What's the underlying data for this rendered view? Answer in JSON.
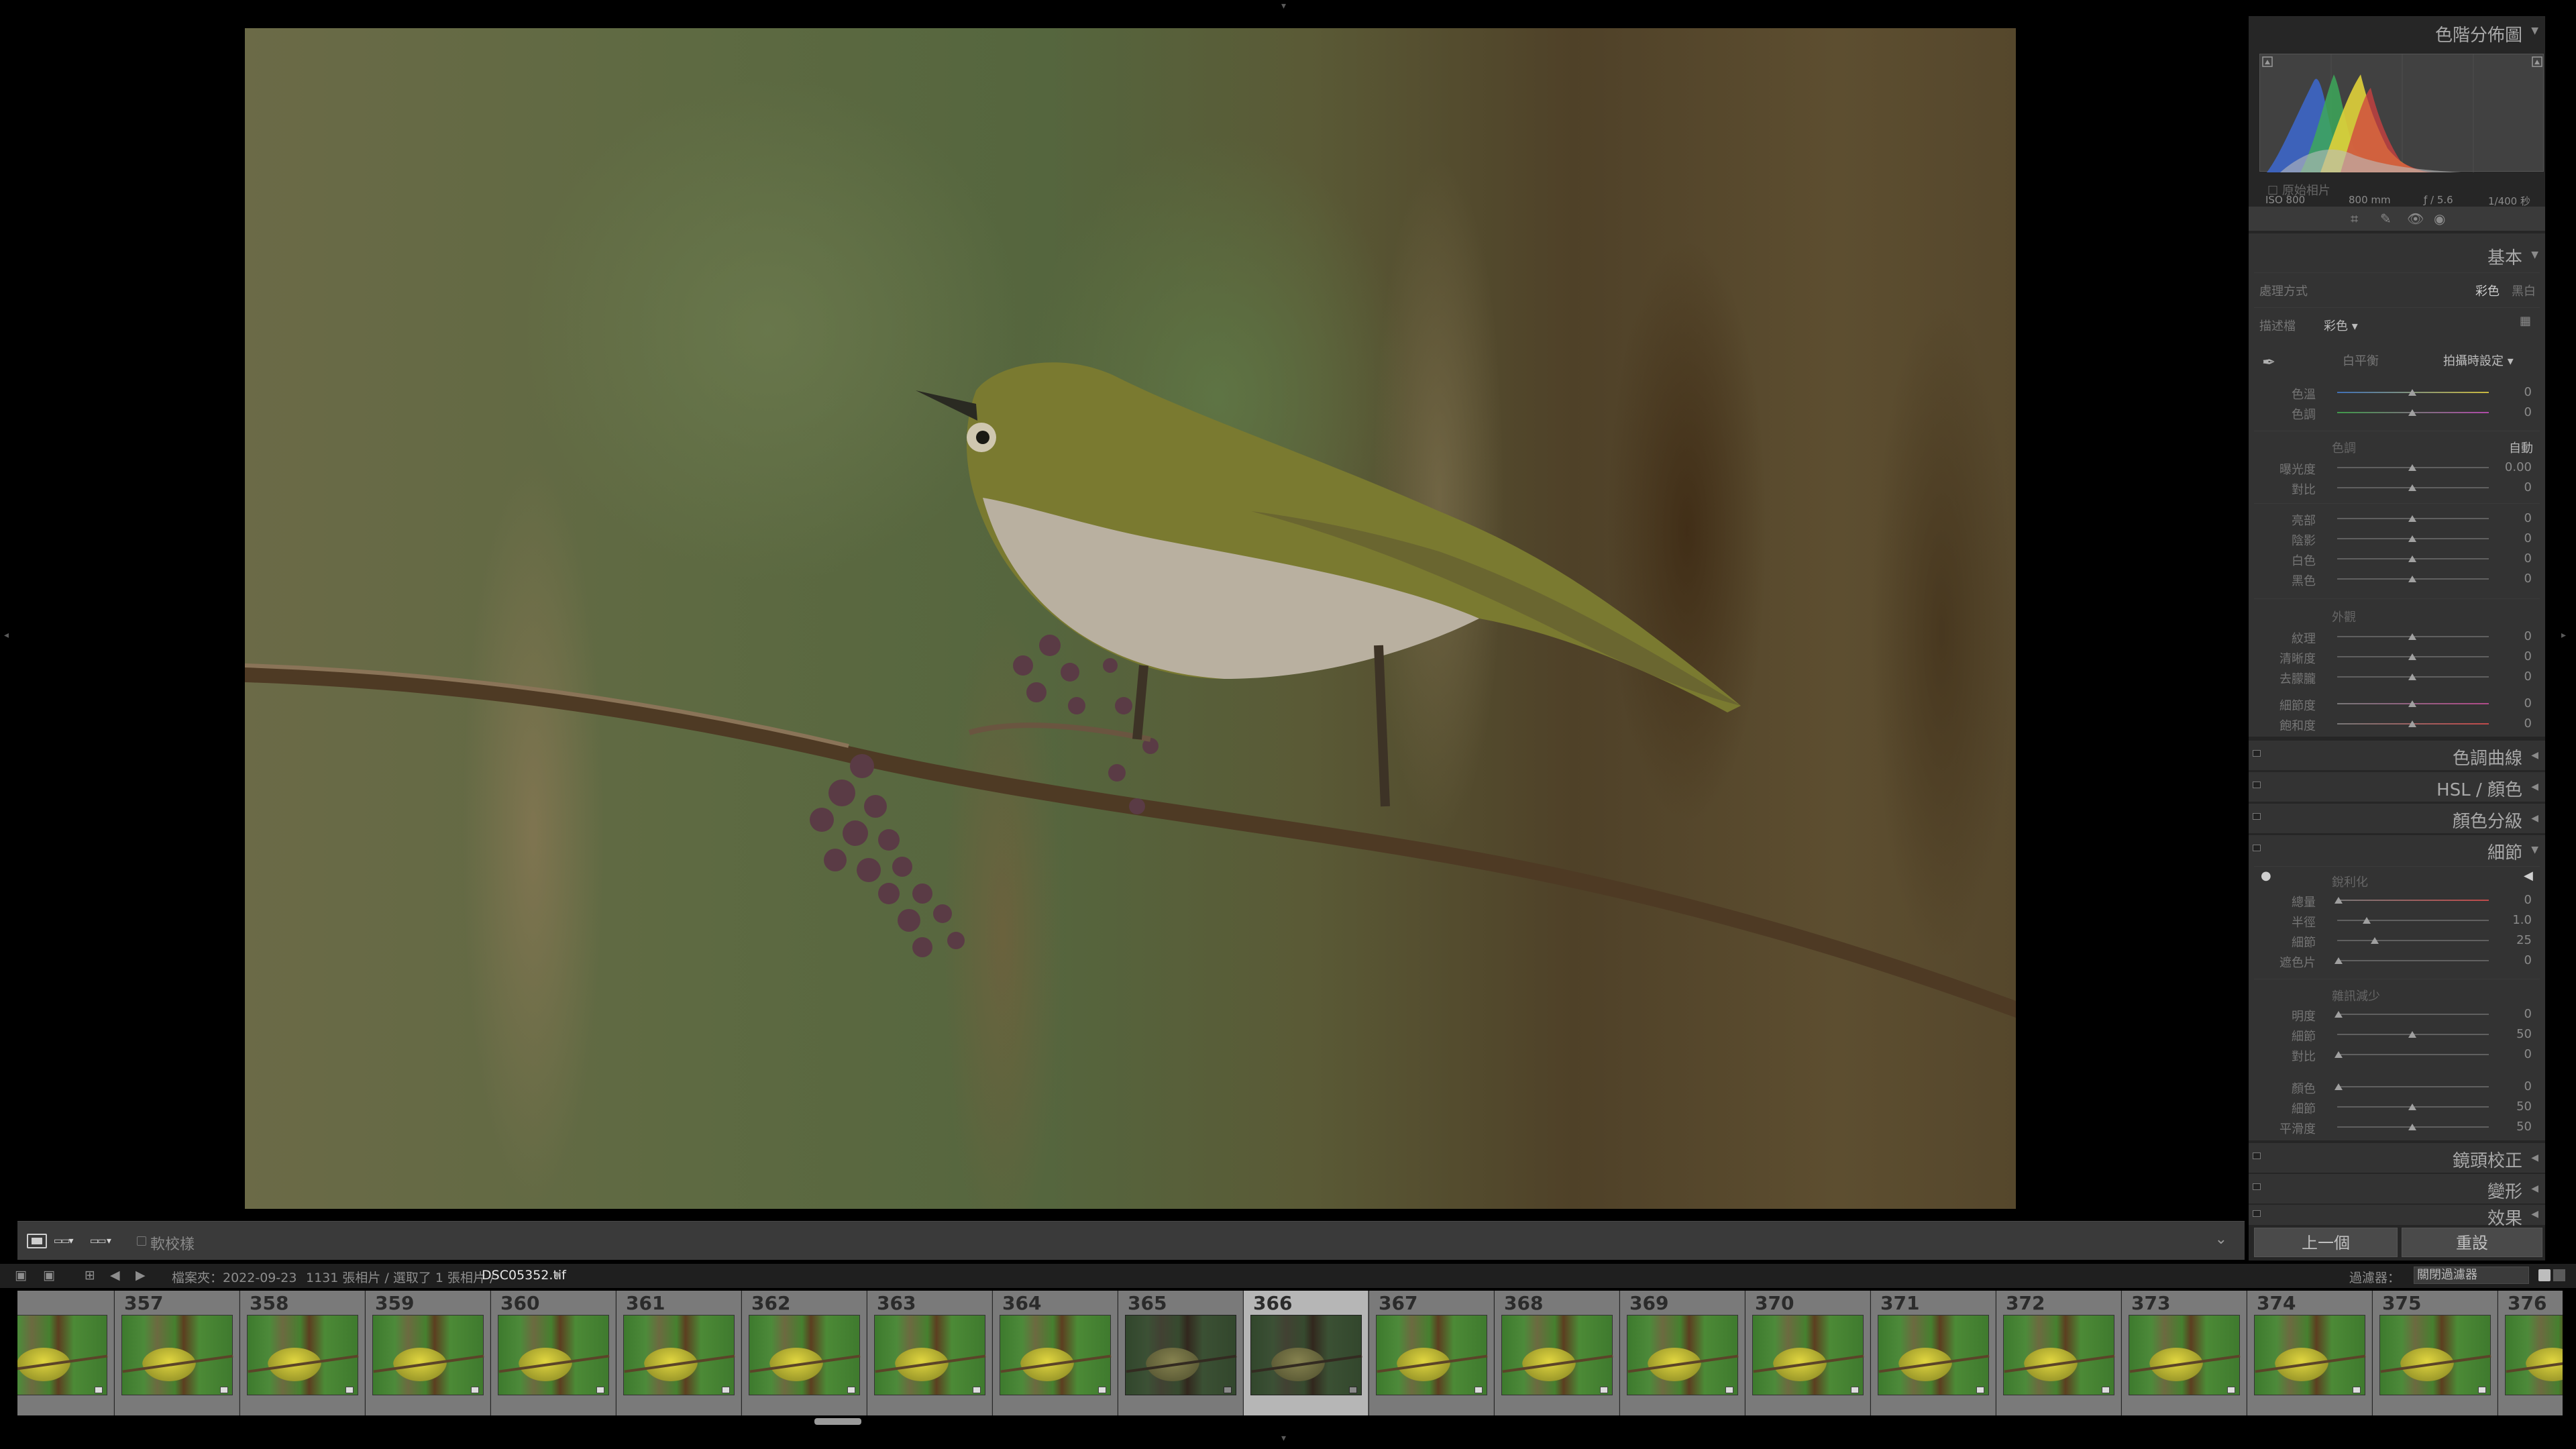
{
  "panels": {
    "histogram_title": "色階分佈圖",
    "exif": {
      "iso": "ISO 800",
      "focal": "800 mm",
      "aperture": "ƒ / 5.6",
      "shutter": "1/400 秒"
    },
    "original_photo": "原始相片",
    "basic": {
      "title": "基本",
      "treatment_label": "處理方式",
      "treatment_color": "彩色",
      "treatment_bw": "黑白",
      "profile_label": "描述檔",
      "profile_value": "彩色",
      "wb_label": "白平衡",
      "wb_value": "拍攝時設定",
      "temp_label": "色溫",
      "tint_label": "色調",
      "tone_label": "色調",
      "auto": "自動",
      "exposure_label": "曝光度",
      "exposure_val": "0.00",
      "contrast_label": "對比",
      "highlights_label": "亮部",
      "shadows_label": "陰影",
      "whites_label": "白色",
      "blacks_label": "黑色",
      "presence_label": "外觀",
      "texture_label": "紋理",
      "clarity_label": "清晰度",
      "dehaze_label": "去朦朧",
      "vibrance_label": "細節度",
      "saturation_label": "飽和度",
      "zero": "0"
    },
    "tone_curve": "色調曲線",
    "hsl": "HSL / 顏色",
    "color_grading": "顏色分級",
    "detail": {
      "title": "細節",
      "sharpen_label": "銳利化",
      "amount_label": "總量",
      "radius_label": "半徑",
      "detail_label": "細節",
      "masking_label": "遮色片",
      "amount_val": "0",
      "radius_val": "1.0",
      "detail_val": "25",
      "masking_val": "0",
      "nr_label": "雜訊減少",
      "lum_label": "明度",
      "lum_detail_label": "細節",
      "lum_contrast_label": "對比",
      "lum_val": "0",
      "lum_detail_val": "50",
      "lum_contrast_val": "0",
      "color_label": "顏色",
      "color_detail_label": "細節",
      "smooth_label": "平滑度",
      "color_val": "0",
      "color_detail_val": "50",
      "smooth_val": "50"
    },
    "lens_correction": "鏡頭校正",
    "transform": "變形",
    "effects": "效果",
    "prev_button": "上一個",
    "reset_button": "重設"
  },
  "toolbar": {
    "soft_proof": "軟校樣"
  },
  "status": {
    "folder": "檔案夾：2022-09-23",
    "count": "1131 張相片 / 選取了 1 張相片 /",
    "filename": "DSC05352.tif",
    "filter_label": "過濾器：",
    "filter_value": "關閉過濾器"
  },
  "filmstrip": {
    "cells": [
      {
        "num": "",
        "dim": false
      },
      {
        "num": "357",
        "dim": false
      },
      {
        "num": "358",
        "dim": false
      },
      {
        "num": "359",
        "dim": false
      },
      {
        "num": "360",
        "dim": false
      },
      {
        "num": "361",
        "dim": false
      },
      {
        "num": "362",
        "dim": false
      },
      {
        "num": "363",
        "dim": false
      },
      {
        "num": "364",
        "dim": false
      },
      {
        "num": "365",
        "dim": true
      },
      {
        "num": "366",
        "dim": true,
        "selected": true
      },
      {
        "num": "367",
        "dim": false
      },
      {
        "num": "368",
        "dim": false
      },
      {
        "num": "369",
        "dim": false
      },
      {
        "num": "370",
        "dim": false
      },
      {
        "num": "371",
        "dim": false
      },
      {
        "num": "372",
        "dim": false
      },
      {
        "num": "373",
        "dim": false
      },
      {
        "num": "374",
        "dim": false
      },
      {
        "num": "375",
        "dim": false
      },
      {
        "num": "376",
        "dim": false
      }
    ]
  }
}
